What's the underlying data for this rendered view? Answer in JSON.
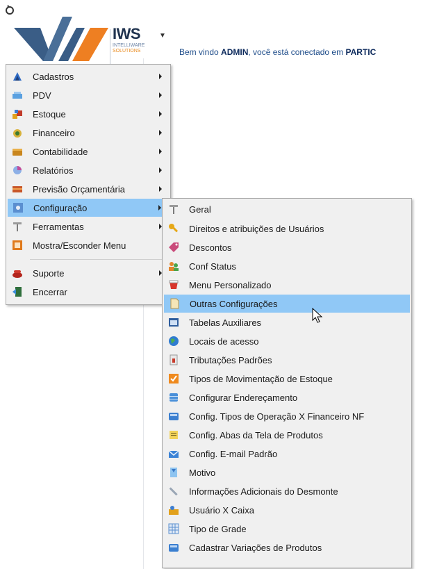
{
  "header": {
    "brand_name": "IWS",
    "brand_sub_1": "INTELLIWARE",
    "brand_sub_2": "SOLUTIONS",
    "welcome_prefix": "Bem vindo ",
    "welcome_user": "ADMIN",
    "welcome_middle": ", você está conectado em ",
    "welcome_tail": "PARTIC"
  },
  "main_menu": {
    "items": [
      {
        "label": "Cadastros",
        "icon": "cadastros-icon"
      },
      {
        "label": "PDV",
        "icon": "pdv-icon"
      },
      {
        "label": "Estoque",
        "icon": "estoque-icon"
      },
      {
        "label": "Financeiro",
        "icon": "financeiro-icon"
      },
      {
        "label": "Contabilidade",
        "icon": "contabilidade-icon"
      },
      {
        "label": "Relatórios",
        "icon": "relatorios-icon"
      },
      {
        "label": "Previsão Orçamentária",
        "icon": "previsao-icon"
      },
      {
        "label": "Configuração",
        "icon": "configuracao-icon"
      },
      {
        "label": "Ferramentas",
        "icon": "ferramentas-icon"
      },
      {
        "label": "Mostra/Esconder Menu",
        "icon": "mostrar-menu-icon"
      },
      {
        "label": "Suporte",
        "icon": "suporte-icon"
      },
      {
        "label": "Encerrar",
        "icon": "encerrar-icon"
      }
    ]
  },
  "sub_menu": {
    "items": [
      {
        "label": "Geral"
      },
      {
        "label": "Direitos e atribuições de Usuários"
      },
      {
        "label": "Descontos"
      },
      {
        "label": "Conf Status"
      },
      {
        "label": "Menu Personalizado"
      },
      {
        "label": "Outras Configurações"
      },
      {
        "label": "Tabelas Auxiliares"
      },
      {
        "label": "Locais de acesso"
      },
      {
        "label": "Tributações Padrões"
      },
      {
        "label": "Tipos de Movimentação de Estoque"
      },
      {
        "label": "Configurar Endereçamento"
      },
      {
        "label": "Config. Tipos de Operação X Financeiro NF"
      },
      {
        "label": "Config. Abas da Tela de Produtos"
      },
      {
        "label": "Config. E-mail Padrão"
      },
      {
        "label": "Motivo"
      },
      {
        "label": "Informações Adicionais do Desmonte"
      },
      {
        "label": "Usuário X Caixa"
      },
      {
        "label": "Tipo de Grade"
      },
      {
        "label": "Cadastrar Variações de Produtos"
      }
    ]
  },
  "colors": {
    "highlight": "#90c8f6",
    "menu_bg": "#f0f0f0",
    "logo_blue": "#3a5d86",
    "logo_orange": "#ee7f22"
  }
}
